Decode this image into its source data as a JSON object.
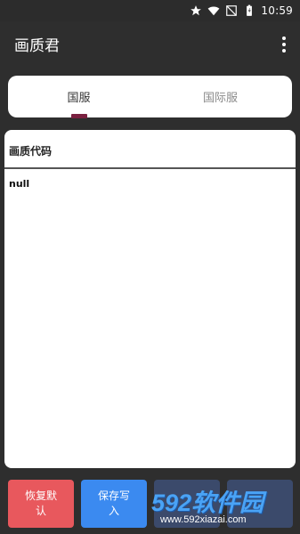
{
  "status_bar": {
    "time": "10:59",
    "icons": [
      "star-icon",
      "wifi-icon",
      "no-sim-icon",
      "battery-icon"
    ]
  },
  "app_bar": {
    "title": "画质君"
  },
  "tabs": [
    {
      "label": "国服",
      "selected": true
    },
    {
      "label": "国际服",
      "selected": false
    }
  ],
  "code_panel": {
    "header": "画质代码",
    "content": "null"
  },
  "buttons": {
    "restore_default": "恢复默认",
    "save_write": "保存写入"
  },
  "watermark": {
    "brand": "592软件园",
    "url": "www.592xiazai.com"
  },
  "colors": {
    "background": "#2e2e2e",
    "restore_button": "#e8585d",
    "save_button": "#3b8af0",
    "tab_indicator": "#7a2040"
  }
}
